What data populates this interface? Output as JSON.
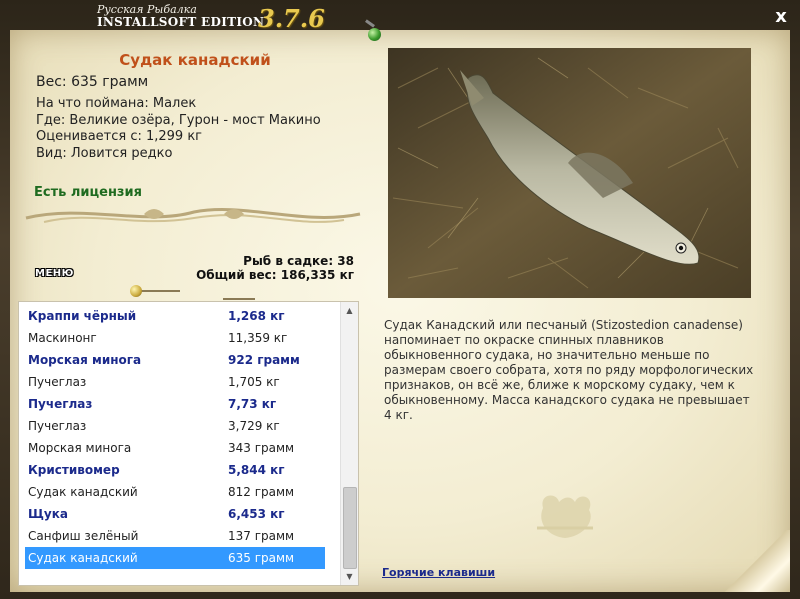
{
  "app": {
    "title": "Русская Рыбалка",
    "brand": "INSTALLSOFT EDITION",
    "version": "3.7.6",
    "close_label": "x"
  },
  "fish": {
    "name": "Судак канадский",
    "weight_line": "Вес: 635 грамм",
    "caught_on": "На что поймана: Малек",
    "location": "Где: Великие озёра, Гурон - мост Макино",
    "valued_from": "Оценивается с: 1,299 кг",
    "kind": "Вид: Ловится редко",
    "license": "Есть лицензия",
    "description": "Судак Канадский или песчаный (Stizostedion canadense) напоминает по окраске спинных плавников обыкновенного судака, но значительно меньше по размерам своего собрата, хотя по ряду морфологических признаков, он всё же, ближе к морскому судаку, чем к обыкновенному. Масса канадского судака не превышает 4 кг."
  },
  "keepnet": {
    "count_line": "Рыб в садке: 38",
    "total_line": "Общий вес: 186,335 кг"
  },
  "menu_label": "МЕНЮ",
  "hotkeys_label": "Горячие клавиши",
  "catch_list": [
    {
      "name": "Краппи чёрный",
      "weight": "1,268 кг",
      "style": "bold"
    },
    {
      "name": "Маскинонг",
      "weight": "11,359 кг",
      "style": "plain"
    },
    {
      "name": "Морская минога",
      "weight": "922 грамм",
      "style": "bold"
    },
    {
      "name": "Пучеглаз",
      "weight": "1,705 кг",
      "style": "plain"
    },
    {
      "name": "Пучеглаз",
      "weight": "7,73 кг",
      "style": "bold"
    },
    {
      "name": "Пучеглаз",
      "weight": "3,729 кг",
      "style": "plain"
    },
    {
      "name": "Морская минога",
      "weight": "343 грамм",
      "style": "plain"
    },
    {
      "name": "Кристивомер",
      "weight": "5,844 кг",
      "style": "bold"
    },
    {
      "name": "Судак канадский",
      "weight": "812 грамм",
      "style": "plain"
    },
    {
      "name": "Щука",
      "weight": "6,453 кг",
      "style": "bold"
    },
    {
      "name": "Санфиш зелёный",
      "weight": "137 грамм",
      "style": "plain"
    },
    {
      "name": "Судак канадский",
      "weight": "635 грамм",
      "style": "selected"
    }
  ],
  "scrollbar": {
    "up_icon": "▲",
    "down_icon": "▼"
  },
  "colors": {
    "title": "#c0501a",
    "license": "#1f6b20",
    "bold_row": "#1b2a8c",
    "selected_row": "#3399ff"
  }
}
